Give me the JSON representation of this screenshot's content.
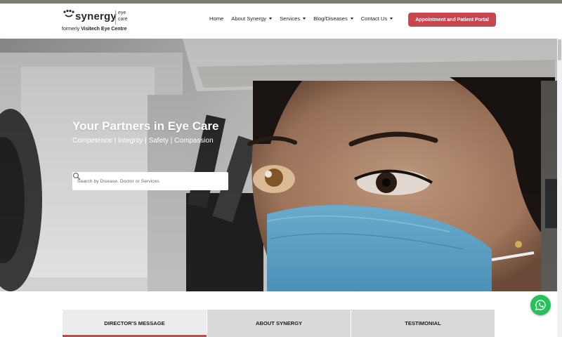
{
  "brand": {
    "name": "synergy",
    "tag_line1": "eye",
    "tag_line2": "care",
    "formerly_prefix": "formerly",
    "formerly_name": "Visitech Eye Centre"
  },
  "nav": {
    "items": [
      {
        "label": "Home",
        "dropdown": false
      },
      {
        "label": "About Synergy",
        "dropdown": true
      },
      {
        "label": "Services",
        "dropdown": true
      },
      {
        "label": "Blog/Diseases",
        "dropdown": true
      },
      {
        "label": "Contact Us",
        "dropdown": true
      }
    ],
    "cta_label": "Appointment and Patient Portal"
  },
  "hero": {
    "title": "Your Partners in Eye Care",
    "subtitle": "Competence | Integrity | Safety | Compassion",
    "search_placeholder": "Search by Disease, Doctor or Services"
  },
  "tabs": [
    {
      "label": "DIRECTOR'S MESSAGE",
      "active": true
    },
    {
      "label": "ABOUT SYNERGY",
      "active": false
    },
    {
      "label": "TESTIMONIAL",
      "active": false
    }
  ],
  "colors": {
    "accent": "#c8474f",
    "whatsapp": "#25c15a"
  },
  "icons": {
    "search": "search-icon",
    "whatsapp": "whatsapp-icon",
    "dropdown": "chevron-down-icon"
  }
}
